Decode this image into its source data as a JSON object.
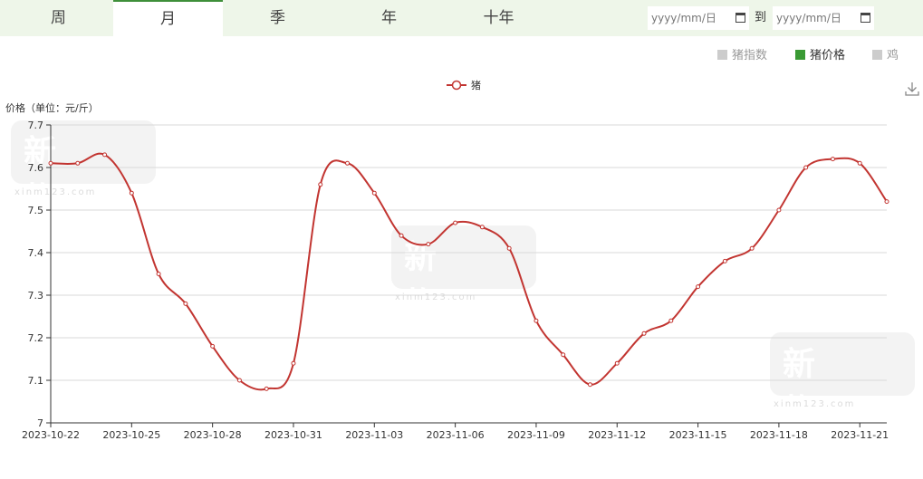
{
  "tabs": [
    {
      "label": "周",
      "active": false
    },
    {
      "label": "月",
      "active": true
    },
    {
      "label": "季",
      "active": false
    },
    {
      "label": "年",
      "active": false
    },
    {
      "label": "十年",
      "active": false
    }
  ],
  "date_range": {
    "start_placeholder": "yyyy/mm/日",
    "separator": "到",
    "end_placeholder": "yyyy/mm/日"
  },
  "switches": [
    {
      "label": "猪指数",
      "active": false
    },
    {
      "label": "猪价格",
      "active": true
    },
    {
      "label": "鸡",
      "active": false
    }
  ],
  "watermark": {
    "text": "新牧网",
    "url": "xinm123.com"
  },
  "colors": {
    "line": "#c23531",
    "accent": "#3a9a34",
    "tab_bar": "#eef6e9"
  },
  "chart_data": {
    "type": "line",
    "ylabel": "价格（单位：元/斤）",
    "ylim": [
      7,
      7.7
    ],
    "yticks": [
      7,
      7.1,
      7.2,
      7.3,
      7.4,
      7.5,
      7.6,
      7.7
    ],
    "xtick_labels": [
      "2023-10-22",
      "2023-10-25",
      "2023-10-28",
      "2023-10-31",
      "2023-11-03",
      "2023-11-06",
      "2023-11-09",
      "2023-11-12",
      "2023-11-15",
      "2023-11-18",
      "2023-11-21"
    ],
    "x": [
      "2023-10-22",
      "2023-10-23",
      "2023-10-24",
      "2023-10-25",
      "2023-10-26",
      "2023-10-27",
      "2023-10-28",
      "2023-10-29",
      "2023-10-30",
      "2023-10-31",
      "2023-11-01",
      "2023-11-02",
      "2023-11-03",
      "2023-11-04",
      "2023-11-05",
      "2023-11-06",
      "2023-11-07",
      "2023-11-08",
      "2023-11-09",
      "2023-11-10",
      "2023-11-11",
      "2023-11-12",
      "2023-11-13",
      "2023-11-14",
      "2023-11-15",
      "2023-11-16",
      "2023-11-17",
      "2023-11-18",
      "2023-11-19",
      "2023-11-20",
      "2023-11-21",
      "2023-11-22"
    ],
    "series": [
      {
        "name": "猪",
        "values": [
          7.61,
          7.61,
          7.63,
          7.54,
          7.35,
          7.28,
          7.18,
          7.1,
          7.08,
          7.14,
          7.56,
          7.61,
          7.54,
          7.44,
          7.42,
          7.47,
          7.46,
          7.41,
          7.24,
          7.16,
          7.09,
          7.14,
          7.21,
          7.24,
          7.32,
          7.38,
          7.41,
          7.5,
          7.6,
          7.62,
          7.61,
          7.52
        ]
      }
    ],
    "legend_position": "top-center",
    "grid": true
  }
}
